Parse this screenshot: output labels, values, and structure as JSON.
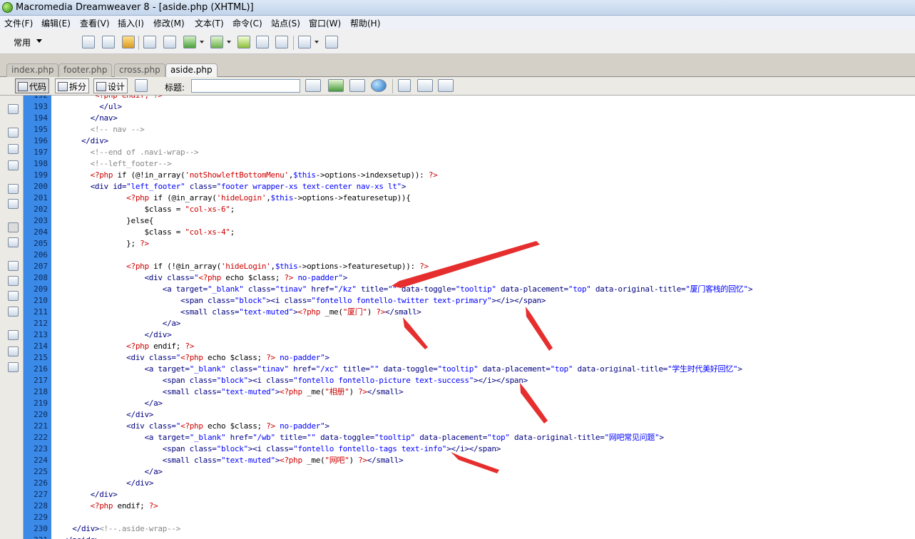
{
  "window": {
    "title": "Macromedia Dreamweaver 8 - [aside.php (XHTML)]"
  },
  "menu": [
    "文件(F)",
    "编辑(E)",
    "查看(V)",
    "插入(I)",
    "修改(M)",
    "文本(T)",
    "命令(C)",
    "站点(S)",
    "窗口(W)",
    "帮助(H)"
  ],
  "insert_bar": {
    "category": "常用"
  },
  "tabs": [
    "index.php",
    "footer.php",
    "cross.php",
    "aside.php"
  ],
  "active_tab": "aside.php",
  "doc_toolbar": {
    "code_label": "代码",
    "split_label": "拆分",
    "design_label": "设计",
    "title_label": "标题:",
    "title_value": ""
  },
  "code": [
    {
      "n": "192",
      "t": [
        [
          "p",
          "<?php endif; ?>"
        ]
      ],
      "i": 9
    },
    {
      "n": "193",
      "t": [
        [
          "t",
          "</ul>"
        ]
      ],
      "i": 10
    },
    {
      "n": "194",
      "t": [
        [
          "t",
          "</nav>"
        ]
      ],
      "i": 8
    },
    {
      "n": "195",
      "t": [
        [
          "c",
          "<!-- nav -->"
        ]
      ],
      "i": 8
    },
    {
      "n": "196",
      "t": [
        [
          "t",
          "</div>"
        ]
      ],
      "i": 6
    },
    {
      "n": "197",
      "t": [
        [
          "c",
          "<!--end of .navi-wrap-->"
        ]
      ],
      "i": 8
    },
    {
      "n": "198",
      "t": [
        [
          "c",
          "<!--left_footer-->"
        ]
      ],
      "i": 8
    },
    {
      "n": "199",
      "t": [
        [
          "p",
          "<?php "
        ],
        [
          "k",
          "if (@!in_array("
        ],
        [
          "p",
          "'notShowleftBottomMenu'"
        ],
        [
          "k",
          ","
        ],
        [
          "v",
          "$this"
        ],
        [
          "k",
          "->options->indexsetup)): "
        ],
        [
          "p",
          "?>"
        ]
      ],
      "i": 8
    },
    {
      "n": "200",
      "t": [
        [
          "t",
          "<div id="
        ],
        [
          "v",
          "\"left_footer\""
        ],
        [
          "t",
          " class="
        ],
        [
          "v",
          "\"footer wrapper-xs text-center nav-xs lt\""
        ],
        [
          "t",
          ">"
        ]
      ],
      "i": 8
    },
    {
      "n": "201",
      "t": [
        [
          "p",
          "<?php "
        ],
        [
          "k",
          "if (@in_array("
        ],
        [
          "p",
          "'hideLogin'"
        ],
        [
          "k",
          ","
        ],
        [
          "v",
          "$this"
        ],
        [
          "k",
          "->options->featuresetup)){"
        ]
      ],
      "i": 16
    },
    {
      "n": "202",
      "t": [
        [
          "k",
          "$class = "
        ],
        [
          "p",
          "\"col-xs-6\""
        ],
        [
          "k",
          ";"
        ]
      ],
      "i": 20
    },
    {
      "n": "203",
      "t": [
        [
          "k",
          "}else{"
        ]
      ],
      "i": 16
    },
    {
      "n": "204",
      "t": [
        [
          "k",
          "$class = "
        ],
        [
          "p",
          "\"col-xs-4\""
        ],
        [
          "k",
          ";"
        ]
      ],
      "i": 20
    },
    {
      "n": "205",
      "t": [
        [
          "k",
          "}; "
        ],
        [
          "p",
          "?>"
        ]
      ],
      "i": 16
    },
    {
      "n": "206",
      "t": [],
      "i": 0
    },
    {
      "n": "207",
      "t": [
        [
          "p",
          "<?php "
        ],
        [
          "k",
          "if (!@in_array("
        ],
        [
          "p",
          "'hideLogin'"
        ],
        [
          "k",
          ","
        ],
        [
          "v",
          "$this"
        ],
        [
          "k",
          "->options->featuresetup)): "
        ],
        [
          "p",
          "?>"
        ]
      ],
      "i": 16
    },
    {
      "n": "208",
      "t": [
        [
          "t",
          "<div class="
        ],
        [
          "v",
          "\""
        ],
        [
          "p",
          "<?php "
        ],
        [
          "k",
          "echo $class; "
        ],
        [
          "p",
          "?>"
        ],
        [
          "v",
          " no-padder\""
        ],
        [
          "t",
          ">"
        ]
      ],
      "i": 20
    },
    {
      "n": "209",
      "t": [
        [
          "t",
          "<a target="
        ],
        [
          "v",
          "\"_blank\""
        ],
        [
          "t",
          " class="
        ],
        [
          "v",
          "\"tinav\""
        ],
        [
          "t",
          " href="
        ],
        [
          "v",
          "\"/kz\""
        ],
        [
          "t",
          " title="
        ],
        [
          "v",
          "\"\""
        ],
        [
          "t",
          " data-toggle="
        ],
        [
          "v",
          "\"tooltip\""
        ],
        [
          "t",
          " data-placement="
        ],
        [
          "v",
          "\"top\""
        ],
        [
          "t",
          " data-original-title="
        ],
        [
          "v",
          "\"厦门客栈的回忆\""
        ],
        [
          "t",
          ">"
        ]
      ],
      "i": 24
    },
    {
      "n": "210",
      "t": [
        [
          "t",
          "<span class="
        ],
        [
          "v",
          "\"block\""
        ],
        [
          "t",
          "><i class="
        ],
        [
          "v",
          "\"fontello fontello-twitter text-primary\""
        ],
        [
          "t",
          "></i></span>"
        ]
      ],
      "i": 28
    },
    {
      "n": "211",
      "t": [
        [
          "t",
          "<small class="
        ],
        [
          "v",
          "\"text-muted\""
        ],
        [
          "t",
          ">"
        ],
        [
          "p",
          "<?php "
        ],
        [
          "k",
          "_me("
        ],
        [
          "p",
          "\"厦门\""
        ],
        [
          "k",
          ") "
        ],
        [
          "p",
          "?>"
        ],
        [
          "t",
          "</small>"
        ]
      ],
      "i": 28
    },
    {
      "n": "212",
      "t": [
        [
          "t",
          "</a>"
        ]
      ],
      "i": 24
    },
    {
      "n": "213",
      "t": [
        [
          "t",
          "</div>"
        ]
      ],
      "i": 20
    },
    {
      "n": "214",
      "t": [
        [
          "p",
          "<?php "
        ],
        [
          "k",
          "endif; "
        ],
        [
          "p",
          "?>"
        ]
      ],
      "i": 16
    },
    {
      "n": "215",
      "t": [
        [
          "t",
          "<div class="
        ],
        [
          "v",
          "\""
        ],
        [
          "p",
          "<?php "
        ],
        [
          "k",
          "echo $class; "
        ],
        [
          "p",
          "?>"
        ],
        [
          "v",
          " no-padder\""
        ],
        [
          "t",
          ">"
        ]
      ],
      "i": 16
    },
    {
      "n": "216",
      "t": [
        [
          "t",
          "<a target="
        ],
        [
          "v",
          "\"_blank\""
        ],
        [
          "t",
          " class="
        ],
        [
          "v",
          "\"tinav\""
        ],
        [
          "t",
          " href="
        ],
        [
          "v",
          "\"/xc\""
        ],
        [
          "t",
          " title="
        ],
        [
          "v",
          "\"\""
        ],
        [
          "t",
          " data-toggle="
        ],
        [
          "v",
          "\"tooltip\""
        ],
        [
          "t",
          " data-placement="
        ],
        [
          "v",
          "\"top\""
        ],
        [
          "t",
          " data-original-title="
        ],
        [
          "v",
          "\"学生时代美好回忆\""
        ],
        [
          "t",
          ">"
        ]
      ],
      "i": 20
    },
    {
      "n": "217",
      "t": [
        [
          "t",
          "<span class="
        ],
        [
          "v",
          "\"block\""
        ],
        [
          "t",
          "><i class="
        ],
        [
          "v",
          "\"fontello fontello-picture text-success\""
        ],
        [
          "t",
          "></i></span>"
        ]
      ],
      "i": 24
    },
    {
      "n": "218",
      "t": [
        [
          "t",
          "<small class="
        ],
        [
          "v",
          "\"text-muted\""
        ],
        [
          "t",
          ">"
        ],
        [
          "p",
          "<?php "
        ],
        [
          "k",
          "_me("
        ],
        [
          "p",
          "\"相册\""
        ],
        [
          "k",
          ") "
        ],
        [
          "p",
          "?>"
        ],
        [
          "t",
          "</small>"
        ]
      ],
      "i": 24
    },
    {
      "n": "219",
      "t": [
        [
          "t",
          "</a>"
        ]
      ],
      "i": 20
    },
    {
      "n": "220",
      "t": [
        [
          "t",
          "</div>"
        ]
      ],
      "i": 16
    },
    {
      "n": "221",
      "t": [
        [
          "t",
          "<div class="
        ],
        [
          "v",
          "\""
        ],
        [
          "p",
          "<?php "
        ],
        [
          "k",
          "echo $class; "
        ],
        [
          "p",
          "?>"
        ],
        [
          "v",
          " no-padder\""
        ],
        [
          "t",
          ">"
        ]
      ],
      "i": 16
    },
    {
      "n": "222",
      "t": [
        [
          "t",
          "<a target="
        ],
        [
          "v",
          "\"_blank\""
        ],
        [
          "t",
          " href="
        ],
        [
          "v",
          "\"/wb\""
        ],
        [
          "t",
          " title="
        ],
        [
          "v",
          "\"\""
        ],
        [
          "t",
          " data-toggle="
        ],
        [
          "v",
          "\"tooltip\""
        ],
        [
          "t",
          " data-placement="
        ],
        [
          "v",
          "\"top\""
        ],
        [
          "t",
          " data-original-title="
        ],
        [
          "v",
          "\"网吧常见问题\""
        ],
        [
          "t",
          ">"
        ]
      ],
      "i": 20
    },
    {
      "n": "223",
      "t": [
        [
          "t",
          "<span class="
        ],
        [
          "v",
          "\"block\""
        ],
        [
          "t",
          "><i class="
        ],
        [
          "v",
          "\"fontello fontello-tags text-info\""
        ],
        [
          "t",
          "></i></span>"
        ]
      ],
      "i": 24
    },
    {
      "n": "224",
      "t": [
        [
          "t",
          "<small class="
        ],
        [
          "v",
          "\"text-muted\""
        ],
        [
          "t",
          ">"
        ],
        [
          "p",
          "<?php "
        ],
        [
          "k",
          "_me("
        ],
        [
          "p",
          "\"网吧\""
        ],
        [
          "k",
          ") "
        ],
        [
          "p",
          "?>"
        ],
        [
          "t",
          "</small>"
        ]
      ],
      "i": 24
    },
    {
      "n": "225",
      "t": [
        [
          "t",
          "</a>"
        ]
      ],
      "i": 20
    },
    {
      "n": "226",
      "t": [
        [
          "t",
          "</div>"
        ]
      ],
      "i": 16
    },
    {
      "n": "227",
      "t": [
        [
          "t",
          "</div>"
        ]
      ],
      "i": 8
    },
    {
      "n": "228",
      "t": [
        [
          "p",
          "<?php "
        ],
        [
          "k",
          "endif; "
        ],
        [
          "p",
          "?>"
        ]
      ],
      "i": 8
    },
    {
      "n": "229",
      "t": [],
      "i": 0
    },
    {
      "n": "230",
      "t": [
        [
          "t",
          "</div>"
        ],
        [
          "c",
          "<!--.aside-wrap-->"
        ]
      ],
      "i": 4
    },
    {
      "n": "231",
      "t": [
        [
          "t",
          "</aside>"
        ]
      ],
      "i": 2
    }
  ],
  "colors": {
    "gutter": "#3c8ae8",
    "tag": "#000080",
    "php": "#cc0000",
    "comment": "#888888",
    "string": "#0000ff",
    "arrow": "#e62e2e"
  }
}
